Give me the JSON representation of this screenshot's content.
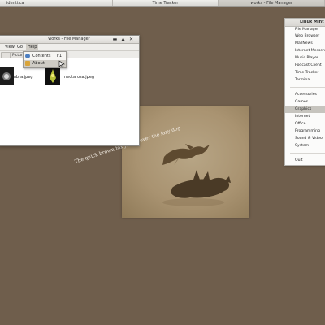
{
  "taskbar": {
    "items": [
      {
        "label": "identi.ca"
      },
      {
        "label": "Time Tracker"
      },
      {
        "label": "works - File Manager"
      }
    ]
  },
  "wallpaper": {
    "quote": "The quick brown fox jumps over the lazy dog"
  },
  "file_manager": {
    "title": "works - File Manager",
    "menu": {
      "view": "View",
      "go": "Go",
      "help": "Help"
    },
    "toolbar": {
      "pictures": "Pictur"
    },
    "files": [
      {
        "name": "kubra.jpeg"
      },
      {
        "name": "nectarosa.jpeg"
      }
    ]
  },
  "help_menu": {
    "items": [
      {
        "label": "Contents",
        "shortcut": "F1"
      },
      {
        "label": "About"
      }
    ]
  },
  "mint_menu": {
    "title": "Linux Mint",
    "favorites": [
      "File Manager",
      "Web Browser",
      "MailNews",
      "Internet Messenger",
      "Music Player",
      "Podcast Client",
      "Time Tracker",
      "Terminal"
    ],
    "categories": [
      "Accessories",
      "Games",
      "Graphics",
      "Internet",
      "Office",
      "Programming",
      "Sound & Video",
      "System"
    ],
    "quit": "Quit"
  }
}
